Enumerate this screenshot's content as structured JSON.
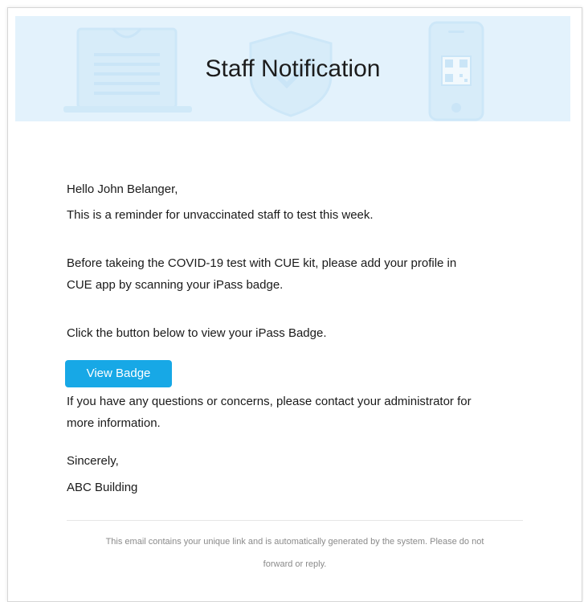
{
  "banner": {
    "title": "Staff Notification",
    "background_color": "#e3f2fc",
    "illustrations": [
      "laptop-icon",
      "shield-check-icon",
      "phone-qr-icon"
    ]
  },
  "message": {
    "greeting": "Hello John Belanger,",
    "line1": "This is a reminder for unvaccinated staff to test this week.",
    "paragraph2_line1": "Before takeing the COVID-19 test with CUE kit, please add your profile in",
    "paragraph2_line2": "CUE app by scanning your iPass badge.",
    "instruction": "Click the button below to view your iPass Badge.",
    "button_label": "View Badge",
    "button_color": "#17a8e6",
    "contact_line1": "If you have any questions or concerns, please contact your administrator for",
    "contact_line2": "more information.",
    "closing": "Sincerely,",
    "signature": "ABC Building"
  },
  "footer": {
    "line1": "This email contains your unique link and is automatically generated by the system. Please do not",
    "line2": "forward or reply."
  }
}
